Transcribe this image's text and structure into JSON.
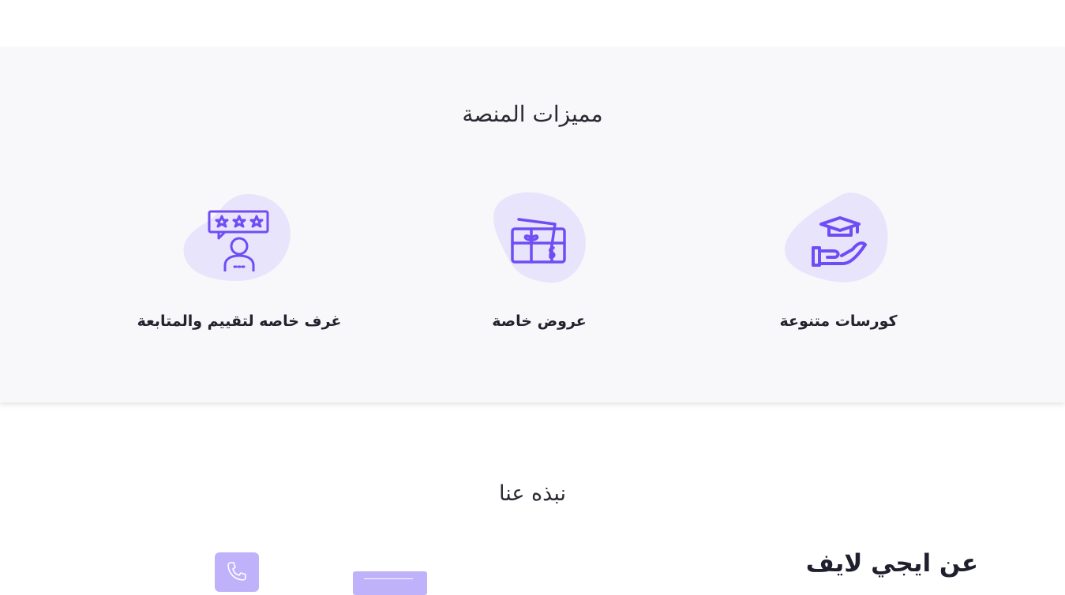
{
  "features": {
    "title": "مميزات المنصة",
    "items": [
      {
        "label": "كورسات متنوعة",
        "icon": "graduation-cap-hand-icon"
      },
      {
        "label": "عروض خاصة",
        "icon": "gift-card-icon"
      },
      {
        "label": "غرف خاصه لتقييم والمتابعة",
        "icon": "rating-person-icon"
      }
    ]
  },
  "about": {
    "title": "نبذه عنا",
    "heading": "عن ايجي لايف"
  },
  "colors": {
    "accent": "#6f4df4",
    "blob": "#e8e4fc",
    "section_bg": "#f8f8fa",
    "tile": "#c0b1fb"
  }
}
